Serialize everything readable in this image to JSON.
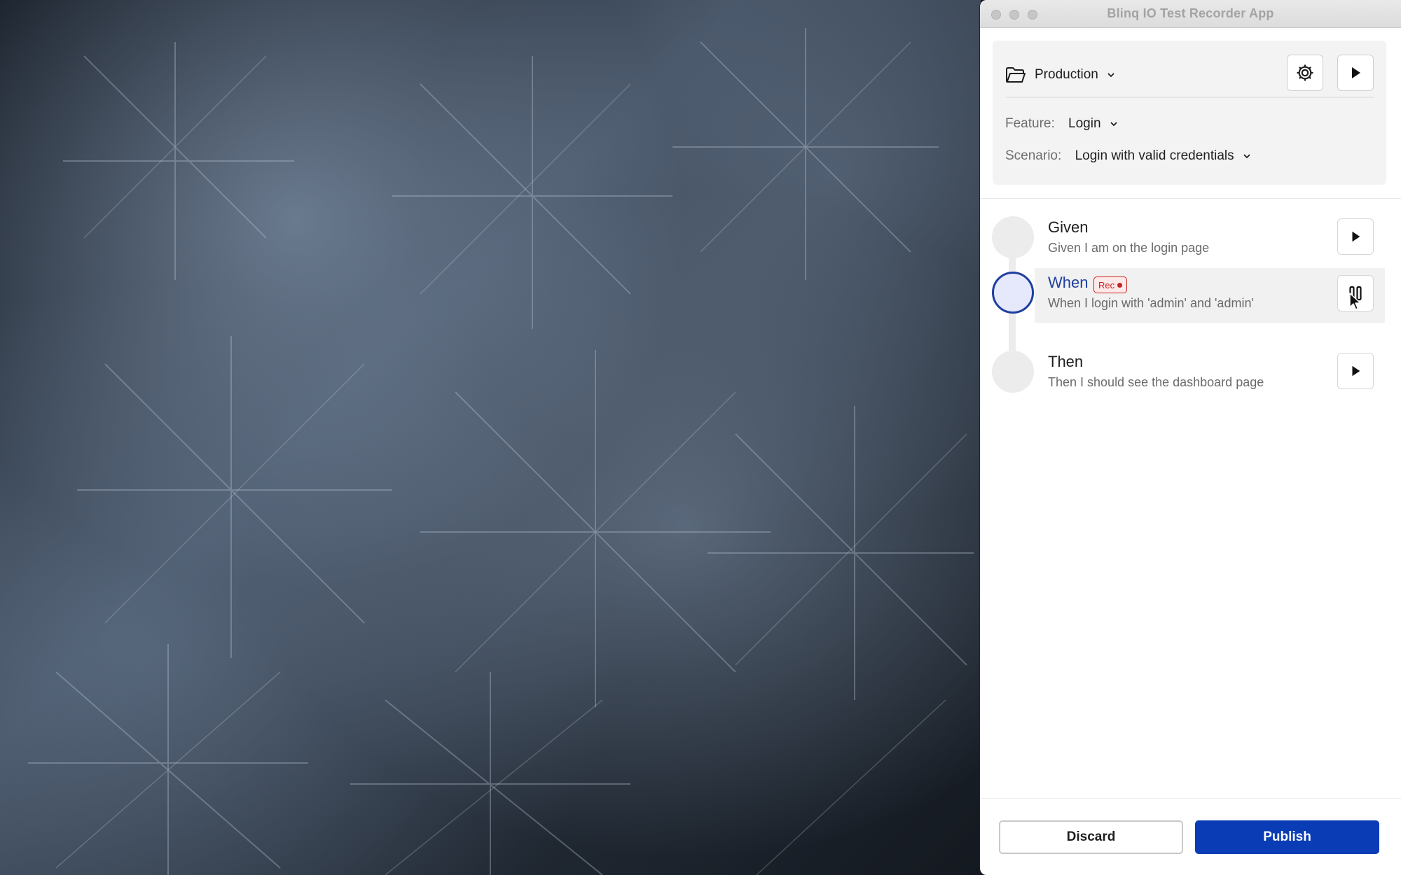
{
  "window": {
    "title": "Blinq IO Test Recorder App"
  },
  "header": {
    "environment": "Production",
    "feature_label": "Feature:",
    "feature_value": "Login",
    "scenario_label": "Scenario:",
    "scenario_value": "Login with valid credentials",
    "settings_icon": "gear-icon",
    "run_icon": "play-icon"
  },
  "steps": [
    {
      "title": "Given",
      "description": "Given I am on the login page",
      "state": "idle",
      "action_icon": "play-icon"
    },
    {
      "title": "When",
      "description": "When I login with 'admin' and 'admin'",
      "state": "recording",
      "badge": "Rec",
      "action_icon": "pause-icon"
    },
    {
      "title": "Then",
      "description": "Then I should see the dashboard page",
      "state": "idle",
      "action_icon": "play-icon"
    }
  ],
  "footer": {
    "discard_label": "Discard",
    "publish_label": "Publish"
  },
  "colors": {
    "accent": "#0a3db5",
    "active_step": "#1f3ea0",
    "recording": "#c7241e"
  }
}
